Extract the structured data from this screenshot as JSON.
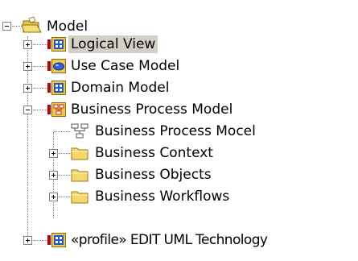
{
  "tree": {
    "root": {
      "label": "Model",
      "icon": "open-folder-package-icon",
      "state": "expanded"
    },
    "children": [
      {
        "label": "Logical View",
        "icon": "class-diagram-package-icon",
        "state": "collapsed",
        "selected": true
      },
      {
        "label": "Use Case Model",
        "icon": "use-case-package-icon",
        "state": "collapsed"
      },
      {
        "label": "Domain Model",
        "icon": "class-diagram-package-icon",
        "state": "collapsed"
      },
      {
        "label": "Business Process Model",
        "icon": "business-process-package-icon",
        "state": "expanded",
        "children": [
          {
            "label": "Business Process Mocel",
            "icon": "business-process-diagram-icon",
            "state": "leaf"
          },
          {
            "label": "Business Context",
            "icon": "folder-icon",
            "state": "collapsed"
          },
          {
            "label": "Business Objects",
            "icon": "folder-icon",
            "state": "collapsed"
          },
          {
            "label": "Business Workflows",
            "icon": "folder-icon",
            "state": "collapsed"
          }
        ]
      },
      {
        "label": "«profile» EDIT UML Technology",
        "icon": "profile-package-icon",
        "state": "collapsed"
      }
    ]
  },
  "colors": {
    "selection": "#d4d0c8",
    "tree_lines": "#808080",
    "package_accent": "#c00000",
    "folder": "#f5d76e"
  }
}
